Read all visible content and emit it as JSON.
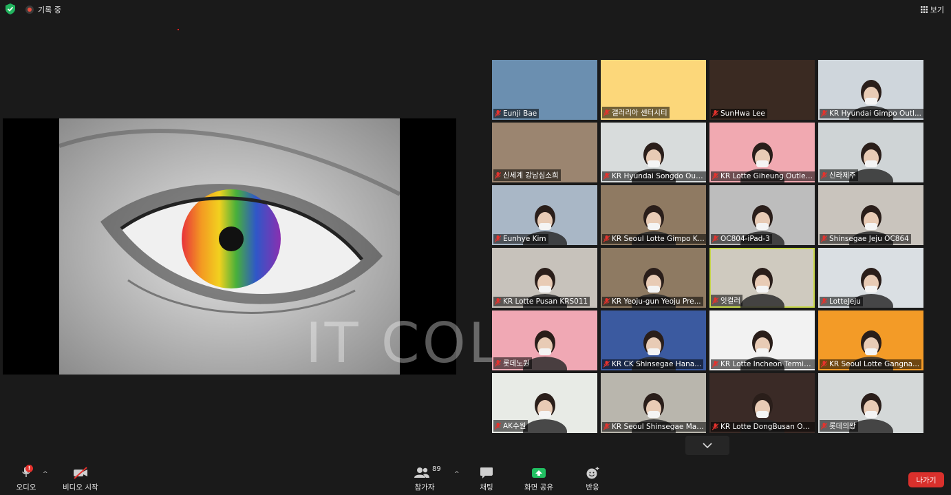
{
  "top_bar": {
    "recording_label": "기록 중",
    "view_label": "보기"
  },
  "shared_screen": {
    "watermark": "IT COLOR"
  },
  "participants": [
    {
      "name": "Eunji Bae",
      "bg": "#6b8fb0"
    },
    {
      "name": "갤러리아 센터시티",
      "bg": "#fcd77a"
    },
    {
      "name": "SunHwa Lee",
      "bg": "#3a2a22"
    },
    {
      "name": "KR Hyundai Gimpo Outl...",
      "bg": "#cfd6dc"
    },
    {
      "name": "신세계 강남심소희",
      "bg": "#9b8570"
    },
    {
      "name": "KR Hyundai Songdo Out...",
      "bg": "#d8dcdc"
    },
    {
      "name": "KR Lotte Giheung Outlet...",
      "bg": "#f1a9b1"
    },
    {
      "name": "신라제주",
      "bg": "#cfd4d6"
    },
    {
      "name": "Eunhye Kim",
      "bg": "#a9b7c6"
    },
    {
      "name": "KR Seoul Lotte Gimpo K...",
      "bg": "#8f7a62"
    },
    {
      "name": "OC804-iPad-3",
      "bg": "#bdbdbd"
    },
    {
      "name": "Shinsegae Jeju OC864",
      "bg": "#c9c4bd"
    },
    {
      "name": "KR Lotte Pusan KRS011",
      "bg": "#c7c2bb"
    },
    {
      "name": "KR Yeoju-gun Yeoju Pre...",
      "bg": "#8e7a62"
    },
    {
      "name": "잇컬러",
      "bg": "#cfcabf",
      "speaking": true
    },
    {
      "name": "LotteJeju",
      "bg": "#dadfe3"
    },
    {
      "name": "롯데노원",
      "bg": "#f0a8b4"
    },
    {
      "name": "KR CK Shinsegae Hana...",
      "bg": "#3b5aa0"
    },
    {
      "name": "KR Lotte Incheon Termin...",
      "bg": "#f2f2f2"
    },
    {
      "name": "KR Seoul Lotte Gangna...",
      "bg": "#f39b27"
    },
    {
      "name": "AK수원",
      "bg": "#e8ebe6"
    },
    {
      "name": "KR Seoul Shinsegae Mai...",
      "bg": "#b9b6ad"
    },
    {
      "name": "KR Lotte DongBusan Ou...",
      "bg": "#3a2a26"
    },
    {
      "name": "롯데의왕",
      "bg": "#d4d8d8"
    }
  ],
  "toolbar": {
    "audio_label": "오디오",
    "audio_badge": "!",
    "video_label": "비디오 시작",
    "participants_label": "참가자",
    "participants_count": "89",
    "chat_label": "채팅",
    "share_label": "화면 공유",
    "reactions_label": "반응",
    "leave_label": "나가기"
  },
  "colors": {
    "share_green": "#21c062",
    "leave_red": "#d9302c",
    "speaker_highlight": "#c8d84a"
  }
}
